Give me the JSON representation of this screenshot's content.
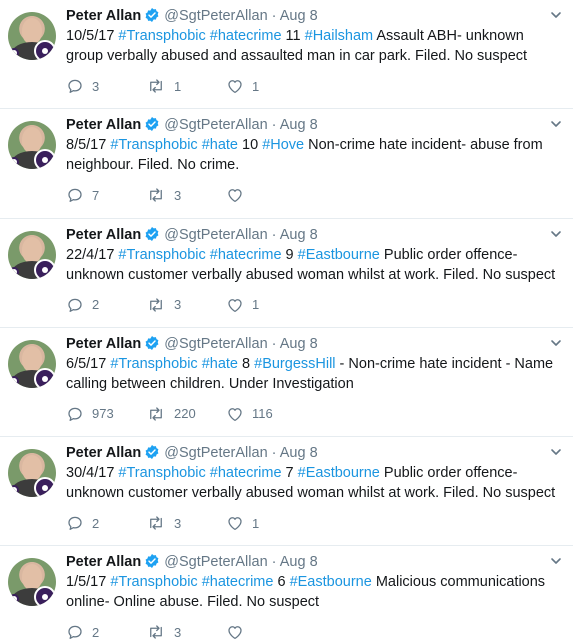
{
  "tweets": [
    {
      "name": "Peter Allan",
      "handle": "@SgtPeterAllan",
      "separator": "·",
      "date": "Aug 8",
      "lead": "10/5/17 ",
      "tag1": "#Transphobic",
      "tag2": "#hatecrime",
      "num": " 11 ",
      "tag3": "#Hailsham",
      "body": " Assault ABH- unknown group verbally abused and assaulted man in car park. Filed. No suspect",
      "replies": "3",
      "retweets": "1",
      "likes": "1"
    },
    {
      "name": "Peter Allan",
      "handle": "@SgtPeterAllan",
      "separator": "·",
      "date": "Aug 8",
      "lead": "8/5/17 ",
      "tag1": "#Transphobic",
      "tag2": "#hate",
      "num": " 10 ",
      "tag3": "#Hove",
      "body": " Non-crime hate incident- abuse from neighbour. Filed. No crime.",
      "replies": "7",
      "retweets": "3",
      "likes": ""
    },
    {
      "name": "Peter Allan",
      "handle": "@SgtPeterAllan",
      "separator": "·",
      "date": "Aug 8",
      "lead": "22/4/17 ",
      "tag1": "#Transphobic",
      "tag2": "#hatecrime",
      "num": " 9 ",
      "tag3": "#Eastbourne",
      "body": " Public order offence- unknown customer verbally abused woman whilst at work. Filed. No suspect",
      "replies": "2",
      "retweets": "3",
      "likes": "1"
    },
    {
      "name": "Peter Allan",
      "handle": "@SgtPeterAllan",
      "separator": "·",
      "date": "Aug 8",
      "lead": "6/5/17 ",
      "tag1": "#Transphobic",
      "tag2": "#hate",
      "num": " 8 ",
      "tag3": "#BurgessHill",
      "body": " - Non-crime hate incident - Name calling between children. Under Investigation",
      "replies": "973",
      "retweets": "220",
      "likes": "116"
    },
    {
      "name": "Peter Allan",
      "handle": "@SgtPeterAllan",
      "separator": "·",
      "date": "Aug 8",
      "lead": "30/4/17 ",
      "tag1": "#Transphobic",
      "tag2": "#hatecrime",
      "num": " 7 ",
      "tag3": "#Eastbourne",
      "body": " Public order offence- unknown customer verbally abused woman whilst at work. Filed. No suspect",
      "replies": "2",
      "retweets": "3",
      "likes": "1"
    },
    {
      "name": "Peter Allan",
      "handle": "@SgtPeterAllan",
      "separator": "·",
      "date": "Aug 8",
      "lead": "1/5/17 ",
      "tag1": "#Transphobic",
      "tag2": "#hatecrime",
      "num": " 6 ",
      "tag3": "#Eastbourne",
      "body": " Malicious communications online- Online abuse. Filed. No suspect",
      "replies": "2",
      "retweets": "3",
      "likes": ""
    }
  ],
  "colors": {
    "link": "#1b95e0",
    "secondary": "#657786",
    "verified": "#1da1f2",
    "divider": "#e6ecf0"
  },
  "icons": {
    "reply": "reply-icon",
    "retweet": "retweet-icon",
    "like": "heart-icon",
    "verified": "verified-badge-icon",
    "menu": "chevron-down-icon"
  }
}
